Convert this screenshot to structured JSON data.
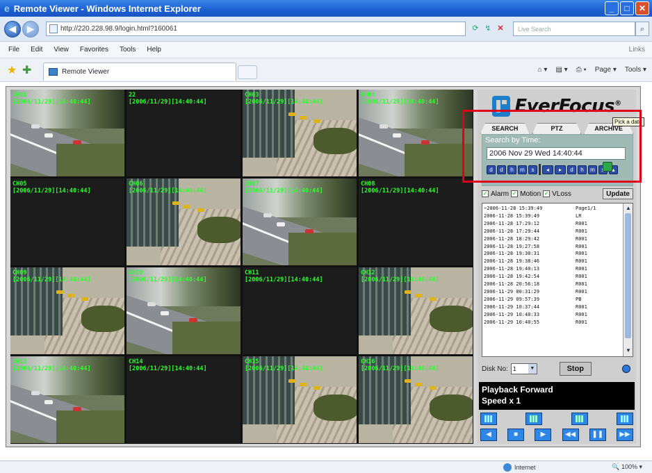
{
  "window": {
    "title": "Remote Viewer - Windows Internet Explorer",
    "minimize": "_",
    "maximize": "□",
    "close": "✕"
  },
  "browser": {
    "address": "http://220.228.98.9/login.html?160061",
    "search_placeholder": "Live Search",
    "menu": [
      "File",
      "Edit",
      "View",
      "Favorites",
      "Tools",
      "Help"
    ],
    "links": "Links",
    "tab_title": "Remote Viewer",
    "cmd": {
      "page": "Page ▾",
      "tools": "Tools ▾"
    },
    "status_zone": "Internet",
    "zoom": "100%"
  },
  "cameras": [
    {
      "line1": "CH01",
      "line2": "[2006/11/29][14:40:44]",
      "scene": "A"
    },
    {
      "line1": "22",
      "line2": "[2006/11/29][14:40:44]",
      "scene": "none"
    },
    {
      "line1": "CH03",
      "line2": "[2006/11/29][14:40:44]",
      "scene": "B"
    },
    {
      "line1": "CH04",
      "line2": "[2006/11/29][14:40:44]",
      "scene": "A"
    },
    {
      "line1": "CH05",
      "line2": "[2006/11/29][14:40:44]",
      "scene": "none"
    },
    {
      "line1": "CH06",
      "line2": "[2006/11/29][14:40:44]",
      "scene": "B"
    },
    {
      "line1": "CH07",
      "line2": "[2006/11/29][14:40:44]",
      "scene": "A"
    },
    {
      "line1": "CH08",
      "line2": "[2006/11/29][14:40:44]",
      "scene": "none"
    },
    {
      "line1": "CH09",
      "line2": "[2006/11/29][14:40:44]",
      "scene": "B"
    },
    {
      "line1": "CH10",
      "line2": "[2006/11/29][14:40:44]",
      "scene": "A"
    },
    {
      "line1": "CH11",
      "line2": "[2006/11/29][14:40:44]",
      "scene": "none"
    },
    {
      "line1": "CH12",
      "line2": "[2006/11/29][14:40:44]",
      "scene": "B"
    },
    {
      "line1": "CH13",
      "line2": "[2006/11/29][14:40:44]",
      "scene": "A"
    },
    {
      "line1": "CH14",
      "line2": "[2006/11/29][14:40:44]",
      "scene": "none"
    },
    {
      "line1": "CH15",
      "line2": "[2006/11/29][14:40:44]",
      "scene": "B"
    },
    {
      "line1": "CH16",
      "line2": "[2006/11/29][14:40:44]",
      "scene": "B"
    }
  ],
  "panel": {
    "logo": "EverFocus",
    "logo_mark": "®",
    "tabs": [
      "SEARCH",
      "PTZ",
      "ARCHIVE"
    ],
    "search_title": "Search by Time:",
    "time_value": "2006 Nov 29 Wed 14:40:44",
    "steppers": [
      "d",
      "d",
      "h",
      "m",
      "s",
      "◂",
      "▸",
      "d",
      "h",
      "m",
      "s",
      "▴"
    ],
    "pick_date_tooltip": "Pick a date",
    "filters": [
      {
        "label": "Alarm",
        "checked": true
      },
      {
        "label": "Motion",
        "checked": true
      },
      {
        "label": "VLoss",
        "checked": true
      }
    ],
    "update_label": "Update",
    "events": [
      {
        "date": "~2006-11-28 15:39:49",
        "code": "Page1/1"
      },
      {
        "date": "2006-11-28 15:39:49",
        "code": "LR"
      },
      {
        "date": "2006-11-28 17:29:12",
        "code": "R001"
      },
      {
        "date": "2006-11-28 17:29:44",
        "code": "R001"
      },
      {
        "date": "2006-11-28 18:29:42",
        "code": "R001"
      },
      {
        "date": "2006-11-28 19:27:58",
        "code": "R001"
      },
      {
        "date": "2006-11-28 19:30:31",
        "code": "R001"
      },
      {
        "date": "2006-11-28 19:38:46",
        "code": "R001"
      },
      {
        "date": "2006-11-28 19:40:13",
        "code": "R001"
      },
      {
        "date": "2006-11-28 19:42:54",
        "code": "R001"
      },
      {
        "date": "2006-11-28 20:56:18",
        "code": "R001"
      },
      {
        "date": "2006-11-29 00:31:29",
        "code": "R001"
      },
      {
        "date": "2006-11-29 09:57:39",
        "code": "PB"
      },
      {
        "date": "2006-11-29 10:37:44",
        "code": "R001"
      },
      {
        "date": "2006-11-29 10:40:33",
        "code": "R001"
      },
      {
        "date": "2006-11-29 10:40:55",
        "code": "R001"
      }
    ],
    "disk_label": "Disk No:",
    "disk_value": "1",
    "stop_label": "Stop",
    "playback_line1": "Playback Forward",
    "playback_line2": "Speed x 1",
    "layout_buttons": [
      "layout-1",
      "layout-4",
      "layout-9",
      "layout-16"
    ],
    "playback_buttons": [
      "◀",
      "■",
      "▶",
      "◀◀",
      "❚❚",
      "▶▶"
    ]
  }
}
